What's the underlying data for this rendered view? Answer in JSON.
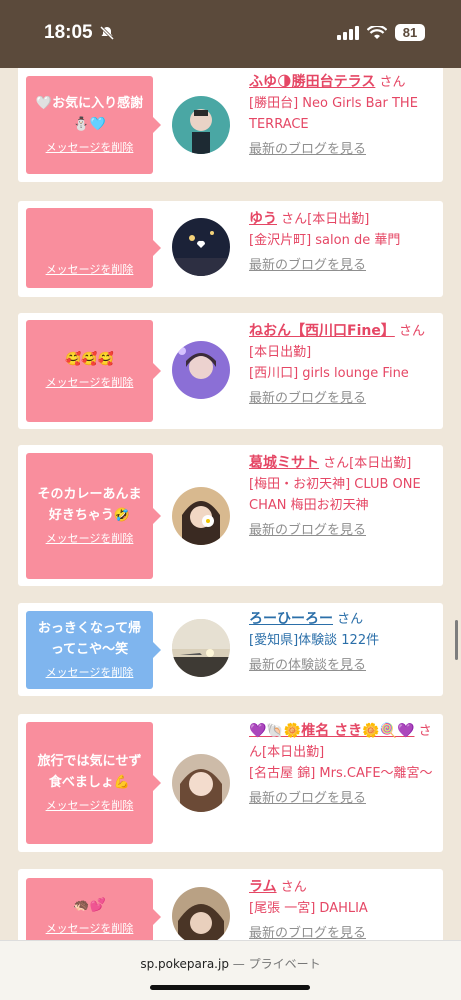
{
  "status_bar": {
    "time": "18:05",
    "battery": "81"
  },
  "cards": [
    {
      "bubble": {
        "message": "🤍お気に入り感謝⛄🩵",
        "delete_label": "メッセージを削除",
        "color": "#f98e9d"
      },
      "name": "ふゆ🌗勝田台テラス",
      "san": "さん",
      "shop": "[勝田台] Neo Girls Bar THE TERRACE",
      "link": "最新のブログを見る"
    },
    {
      "bubble": {
        "message": "",
        "delete_label": "メッセージを削除",
        "color": "#f98e9d"
      },
      "name": "ゆう",
      "san": "さん[本日出勤]",
      "shop": "[金沢片町] salon de 華門",
      "link": "最新のブログを見る"
    },
    {
      "bubble": {
        "message": "🥰🥰🥰",
        "delete_label": "メッセージを削除",
        "color": "#f98e9d"
      },
      "name": "ねおん【西川口Fine】",
      "san": "さん[本日出勤]",
      "shop": "[西川口] girls lounge Fine",
      "link": "最新のブログを見る"
    },
    {
      "bubble": {
        "message": "そのカレーあんま好きちゃう🤣",
        "delete_label": "メッセージを削除",
        "color": "#f98e9d"
      },
      "name": "葛城ミサト",
      "san": "さん[本日出勤]",
      "shop": "[梅田・お初天神] CLUB ONE CHAN 梅田お初天神",
      "link": "最新のブログを見る"
    },
    {
      "bubble": {
        "message": "おっきくなって帰ってこや〜笑",
        "delete_label": "メッセージを削除",
        "color": "#7fb5ee"
      },
      "name": "ろーひーろー",
      "san": "さん",
      "shop": "[愛知県]体験談 122件",
      "link": "最新の体験談を見る"
    },
    {
      "bubble": {
        "message": "旅行では気にせず食べましょ💪",
        "delete_label": "メッセージを削除",
        "color": "#f98e9d"
      },
      "name": "💜🐚🌼椎名 さき🌼🍭💜",
      "san": "さん[本日出勤]",
      "shop": "[名古屋 錦] Mrs.CAFE〜離宮〜",
      "link": "最新のブログを見る"
    },
    {
      "bubble": {
        "message": "🦔💕",
        "delete_label": "メッセージを削除",
        "color": "#f98e9d"
      },
      "name": "ラム",
      "san": "さん",
      "shop": "[尾張 一宮] DAHLIA",
      "link": "最新のブログを見る"
    }
  ],
  "browser": {
    "url": "sp.pokepara.jp",
    "separator": "—",
    "mode": "プライベート"
  }
}
